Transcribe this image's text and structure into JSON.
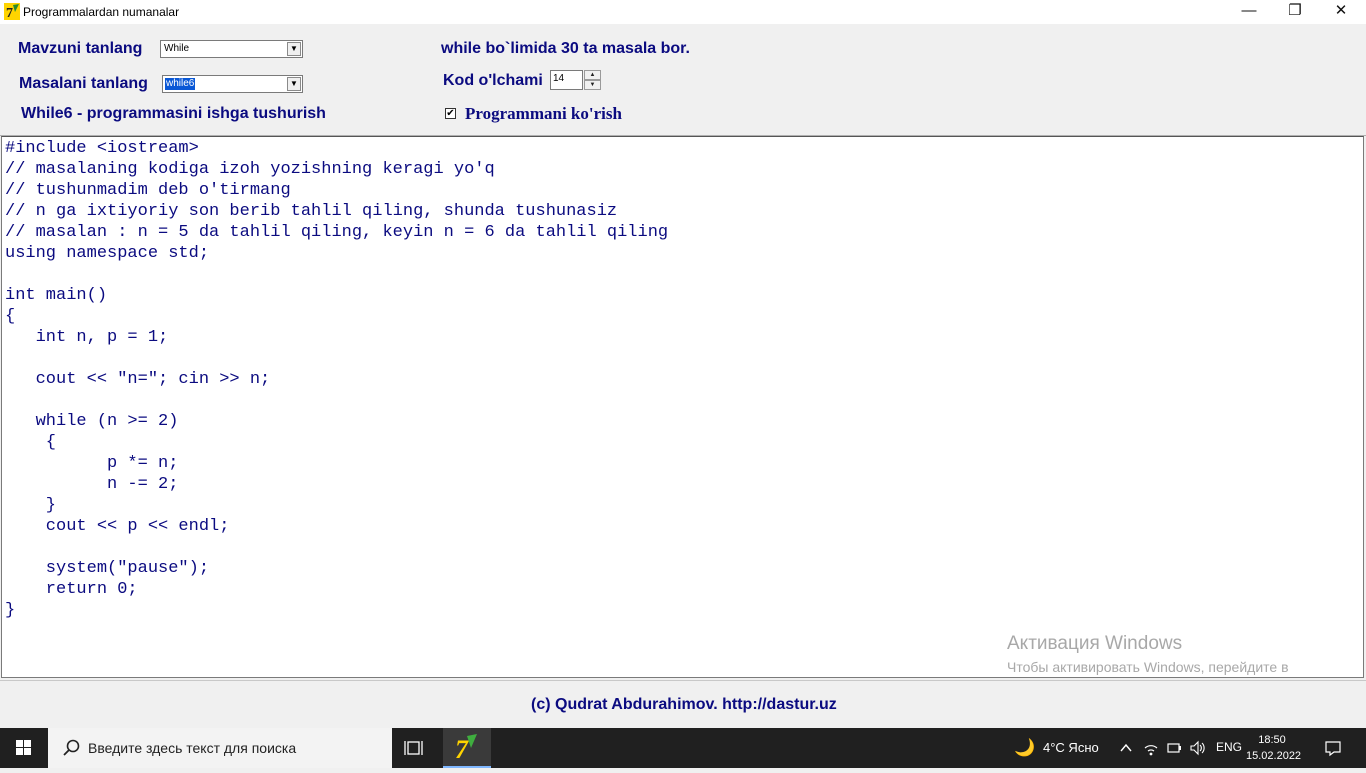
{
  "window": {
    "title": "Programmalardan numanalar",
    "minimize_glyph": "—",
    "maximize_glyph": "❐",
    "close_glyph": "✕"
  },
  "header": {
    "topic_label": "Mavzuni  tanlang",
    "topic_value": "While",
    "problem_label": "Masalani tanlang",
    "problem_value": "while6",
    "run_label": "While6 - programmasini ishga tushurish",
    "info_text": "while bo`limida 30 ta masala bor.",
    "code_size_label": "Kod o'lchami",
    "code_size_value": "14",
    "show_program_label": "Programmani ko'rish",
    "show_program_checked": true
  },
  "code": {
    "lines": [
      "#include <iostream>",
      "// masalaning kodiga izoh yozishning keragi yo'q",
      "// tushunmadim deb o'tirmang",
      "// n ga ixtiyoriy son berib tahlil qiling, shunda tushunasiz",
      "// masalan : n = 5 da tahlil qiling, keyin n = 6 da tahlil qiling",
      "using namespace std;",
      "",
      "int main()",
      "{",
      "   int n, p = 1;",
      "",
      "   cout << \"n=\"; cin >> n;",
      "",
      "   while (n >= 2)",
      "    {",
      "          p *= n;",
      "          n -= 2;",
      "    }",
      "    cout << p << endl;",
      "",
      "    system(\"pause\");",
      "    return 0;",
      "}"
    ]
  },
  "watermark": {
    "title": "Активация Windows",
    "subtitle": "Чтобы активировать Windows, перейдите в раздел \"Параметры\"."
  },
  "footer": {
    "text": "(c) Qudrat Abdurahimov. http://dastur.uz"
  },
  "taskbar": {
    "search_placeholder": "Введите здесь текст для поиска",
    "weather": "4°C  Ясно",
    "language": "ENG",
    "time": "18:50",
    "date": "15.02.2022"
  },
  "colors": {
    "label_blue": "#0b0b80",
    "selection": "#0a58d6",
    "taskbar": "#202020"
  }
}
